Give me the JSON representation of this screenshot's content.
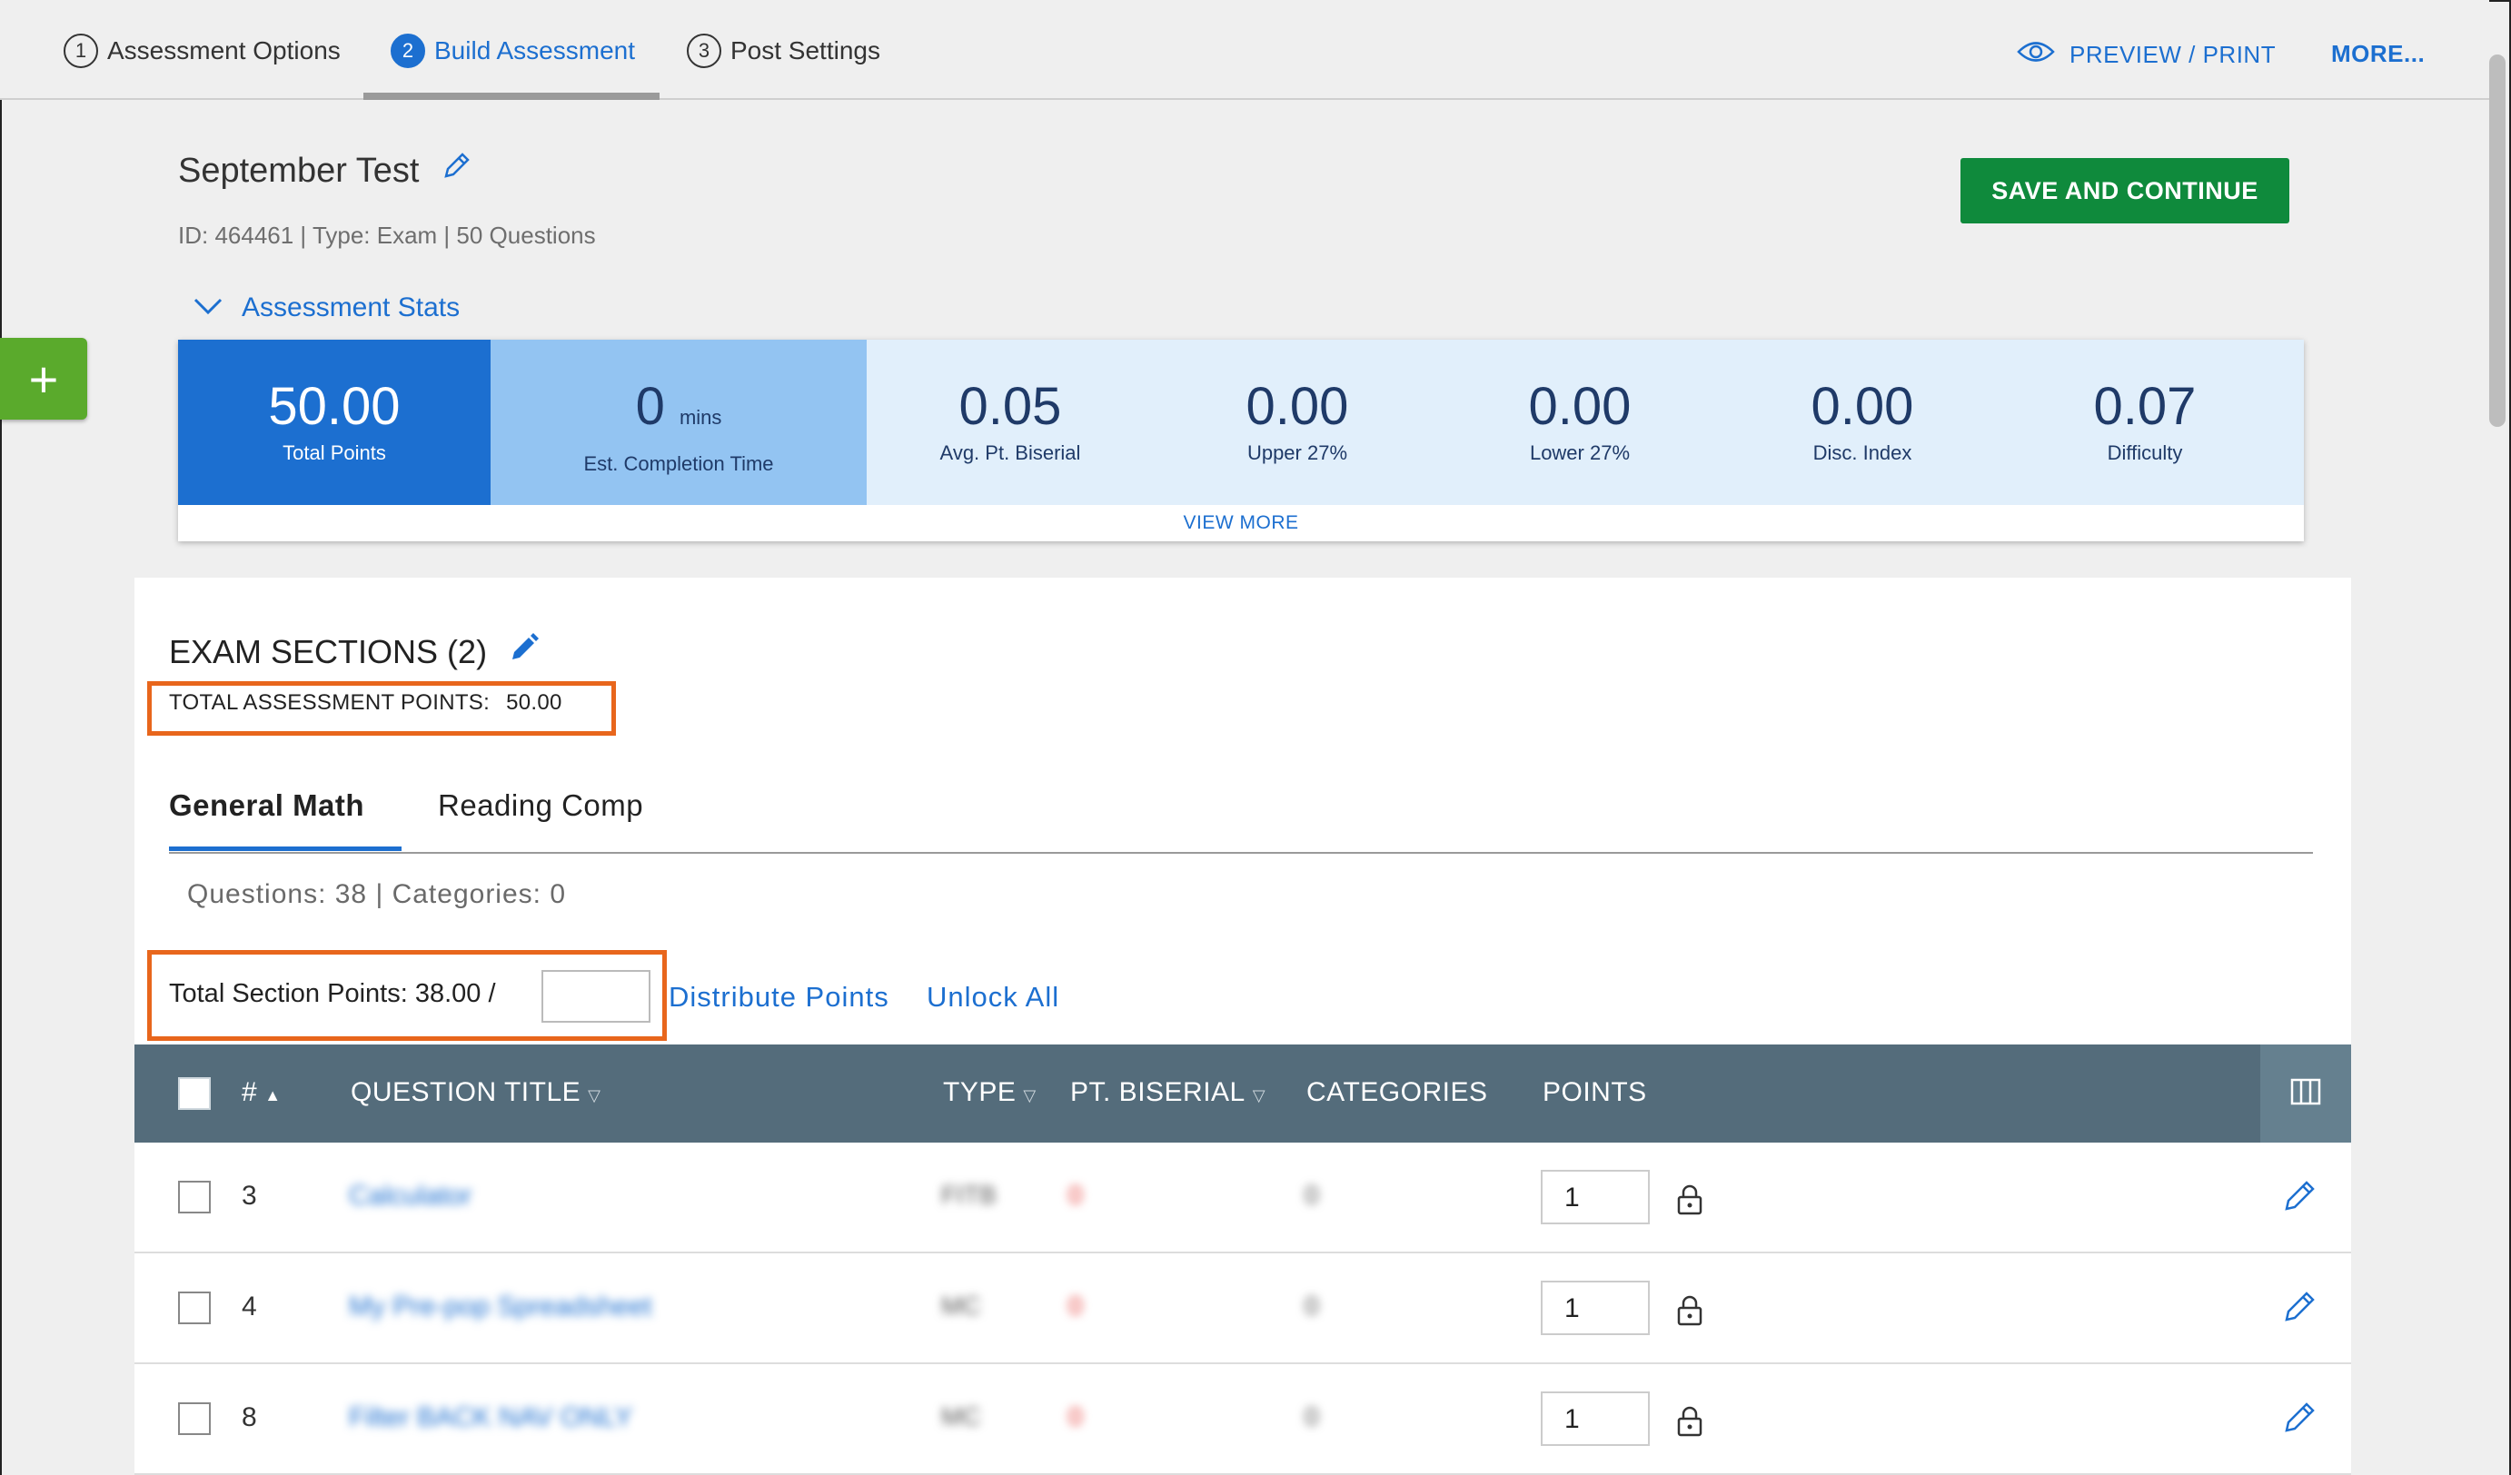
{
  "steps": [
    {
      "num": "1",
      "label": "Assessment Options"
    },
    {
      "num": "2",
      "label": "Build Assessment"
    },
    {
      "num": "3",
      "label": "Post Settings"
    }
  ],
  "toplinks": {
    "preview": "PREVIEW / PRINT",
    "more": "MORE..."
  },
  "header": {
    "title": "September Test",
    "meta": "ID: 464461 | Type: Exam | 50 Questions",
    "save_label": "SAVE AND CONTINUE",
    "stats_toggle": "Assessment Stats"
  },
  "stats": {
    "total": {
      "value": "50.00",
      "label": "Total Points"
    },
    "time": {
      "value": "0",
      "unit": "mins",
      "label": "Est. Completion Time"
    },
    "metrics": [
      {
        "value": "0.05",
        "label": "Avg. Pt. Biserial"
      },
      {
        "value": "0.00",
        "label": "Upper 27%"
      },
      {
        "value": "0.00",
        "label": "Lower 27%"
      },
      {
        "value": "0.00",
        "label": "Disc. Index"
      },
      {
        "value": "0.07",
        "label": "Difficulty"
      }
    ],
    "view_more": "VIEW MORE"
  },
  "sections": {
    "title": "EXAM SECTIONS (2)",
    "total_points_label": "TOTAL ASSESSMENT POINTS:",
    "total_points_value": "50.00",
    "tabs": [
      "General Math",
      "Reading Comp"
    ],
    "qcount": "Questions:  38   |   Categories:  0",
    "section_points": "Total Section Points: 38.00 /",
    "distribute": "Distribute Points",
    "unlock": "Unlock All"
  },
  "table": {
    "columns": {
      "num": "#",
      "title": "QUESTION TITLE",
      "type": "TYPE",
      "biserial": "PT. BISERIAL",
      "categories": "CATEGORIES",
      "points": "POINTS"
    },
    "rows": [
      {
        "num": "3",
        "title": "Calculator",
        "type": "FITB",
        "biserial": "0",
        "categories": "0",
        "points": "1"
      },
      {
        "num": "4",
        "title": "My Pre-pop Spreadsheet",
        "type": "MC",
        "biserial": "0",
        "categories": "0",
        "points": "1"
      },
      {
        "num": "8",
        "title": "Filter BACK NAV ONLY",
        "type": "MC",
        "biserial": "0",
        "categories": "0",
        "points": "1"
      }
    ]
  },
  "colors": {
    "accent": "#1c6fd0",
    "save": "#0f8a3c",
    "add": "#5aaa2c",
    "highlight": "#e8661c",
    "table_header": "#546c7b"
  }
}
